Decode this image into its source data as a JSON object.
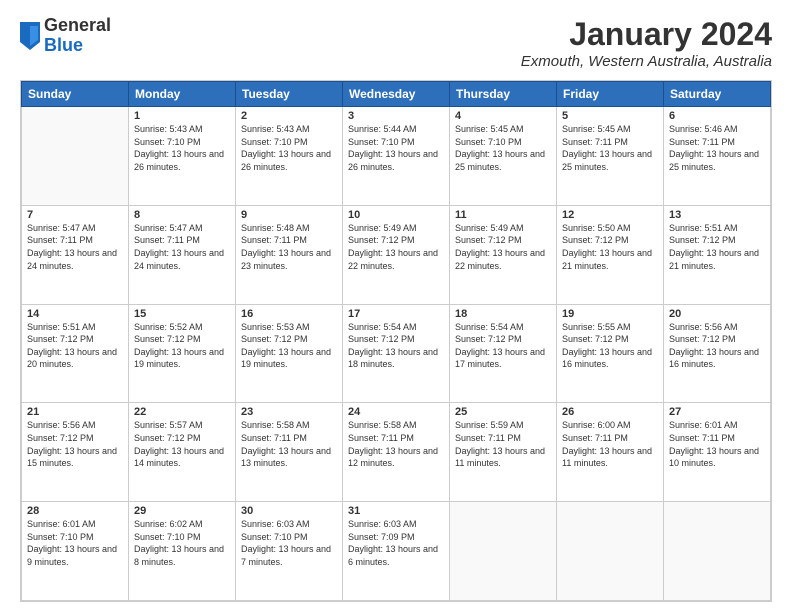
{
  "header": {
    "logo_general": "General",
    "logo_blue": "Blue",
    "main_title": "January 2024",
    "subtitle": "Exmouth, Western Australia, Australia"
  },
  "calendar": {
    "days_of_week": [
      "Sunday",
      "Monday",
      "Tuesday",
      "Wednesday",
      "Thursday",
      "Friday",
      "Saturday"
    ],
    "weeks": [
      [
        {
          "num": "",
          "info": ""
        },
        {
          "num": "1",
          "info": "Sunrise: 5:43 AM\nSunset: 7:10 PM\nDaylight: 13 hours\nand 26 minutes."
        },
        {
          "num": "2",
          "info": "Sunrise: 5:43 AM\nSunset: 7:10 PM\nDaylight: 13 hours\nand 26 minutes."
        },
        {
          "num": "3",
          "info": "Sunrise: 5:44 AM\nSunset: 7:10 PM\nDaylight: 13 hours\nand 26 minutes."
        },
        {
          "num": "4",
          "info": "Sunrise: 5:45 AM\nSunset: 7:10 PM\nDaylight: 13 hours\nand 25 minutes."
        },
        {
          "num": "5",
          "info": "Sunrise: 5:45 AM\nSunset: 7:11 PM\nDaylight: 13 hours\nand 25 minutes."
        },
        {
          "num": "6",
          "info": "Sunrise: 5:46 AM\nSunset: 7:11 PM\nDaylight: 13 hours\nand 25 minutes."
        }
      ],
      [
        {
          "num": "7",
          "info": "Sunrise: 5:47 AM\nSunset: 7:11 PM\nDaylight: 13 hours\nand 24 minutes."
        },
        {
          "num": "8",
          "info": "Sunrise: 5:47 AM\nSunset: 7:11 PM\nDaylight: 13 hours\nand 24 minutes."
        },
        {
          "num": "9",
          "info": "Sunrise: 5:48 AM\nSunset: 7:11 PM\nDaylight: 13 hours\nand 23 minutes."
        },
        {
          "num": "10",
          "info": "Sunrise: 5:49 AM\nSunset: 7:12 PM\nDaylight: 13 hours\nand 22 minutes."
        },
        {
          "num": "11",
          "info": "Sunrise: 5:49 AM\nSunset: 7:12 PM\nDaylight: 13 hours\nand 22 minutes."
        },
        {
          "num": "12",
          "info": "Sunrise: 5:50 AM\nSunset: 7:12 PM\nDaylight: 13 hours\nand 21 minutes."
        },
        {
          "num": "13",
          "info": "Sunrise: 5:51 AM\nSunset: 7:12 PM\nDaylight: 13 hours\nand 21 minutes."
        }
      ],
      [
        {
          "num": "14",
          "info": "Sunrise: 5:51 AM\nSunset: 7:12 PM\nDaylight: 13 hours\nand 20 minutes."
        },
        {
          "num": "15",
          "info": "Sunrise: 5:52 AM\nSunset: 7:12 PM\nDaylight: 13 hours\nand 19 minutes."
        },
        {
          "num": "16",
          "info": "Sunrise: 5:53 AM\nSunset: 7:12 PM\nDaylight: 13 hours\nand 19 minutes."
        },
        {
          "num": "17",
          "info": "Sunrise: 5:54 AM\nSunset: 7:12 PM\nDaylight: 13 hours\nand 18 minutes."
        },
        {
          "num": "18",
          "info": "Sunrise: 5:54 AM\nSunset: 7:12 PM\nDaylight: 13 hours\nand 17 minutes."
        },
        {
          "num": "19",
          "info": "Sunrise: 5:55 AM\nSunset: 7:12 PM\nDaylight: 13 hours\nand 16 minutes."
        },
        {
          "num": "20",
          "info": "Sunrise: 5:56 AM\nSunset: 7:12 PM\nDaylight: 13 hours\nand 16 minutes."
        }
      ],
      [
        {
          "num": "21",
          "info": "Sunrise: 5:56 AM\nSunset: 7:12 PM\nDaylight: 13 hours\nand 15 minutes."
        },
        {
          "num": "22",
          "info": "Sunrise: 5:57 AM\nSunset: 7:12 PM\nDaylight: 13 hours\nand 14 minutes."
        },
        {
          "num": "23",
          "info": "Sunrise: 5:58 AM\nSunset: 7:11 PM\nDaylight: 13 hours\nand 13 minutes."
        },
        {
          "num": "24",
          "info": "Sunrise: 5:58 AM\nSunset: 7:11 PM\nDaylight: 13 hours\nand 12 minutes."
        },
        {
          "num": "25",
          "info": "Sunrise: 5:59 AM\nSunset: 7:11 PM\nDaylight: 13 hours\nand 11 minutes."
        },
        {
          "num": "26",
          "info": "Sunrise: 6:00 AM\nSunset: 7:11 PM\nDaylight: 13 hours\nand 11 minutes."
        },
        {
          "num": "27",
          "info": "Sunrise: 6:01 AM\nSunset: 7:11 PM\nDaylight: 13 hours\nand 10 minutes."
        }
      ],
      [
        {
          "num": "28",
          "info": "Sunrise: 6:01 AM\nSunset: 7:10 PM\nDaylight: 13 hours\nand 9 minutes."
        },
        {
          "num": "29",
          "info": "Sunrise: 6:02 AM\nSunset: 7:10 PM\nDaylight: 13 hours\nand 8 minutes."
        },
        {
          "num": "30",
          "info": "Sunrise: 6:03 AM\nSunset: 7:10 PM\nDaylight: 13 hours\nand 7 minutes."
        },
        {
          "num": "31",
          "info": "Sunrise: 6:03 AM\nSunset: 7:09 PM\nDaylight: 13 hours\nand 6 minutes."
        },
        {
          "num": "",
          "info": ""
        },
        {
          "num": "",
          "info": ""
        },
        {
          "num": "",
          "info": ""
        }
      ]
    ]
  }
}
